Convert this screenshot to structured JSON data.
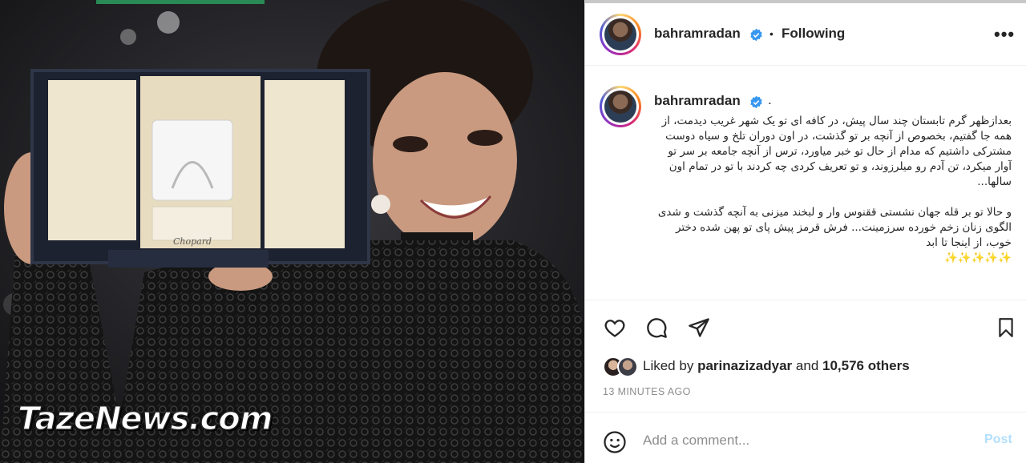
{
  "photo": {
    "description_icon": "photo-award-winner",
    "watermark": "TazeNews.com",
    "trophy_brand": "Chopard"
  },
  "header": {
    "username": "bahramradan",
    "separator": "•",
    "follow_status": "Following",
    "more_label": "•••"
  },
  "caption": {
    "username": "bahramradan",
    "suffix": ".",
    "paragraph1": "بعدازظهر گرم تابستان چند سال پیش، در کافه ای تو یک شهر غریب دیدمت، از همه جا گفتیم، بخصوص از آنچه بر تو گذشت، در اون دوران تلخ و سیاه دوست مشترکی داشتیم که مدام از حال تو خبر میاورد، ترس از آنچه جامعه بر سر تو آوار میکرد، تن آدم رو میلرزوند، و تو تعریف کردی چه کردند با تو در تمام اون سالها...",
    "paragraph2": "و حالا تو بر قله جهان نشستی ققنوس وار و لبخند میزنی به آنچه گذشت و شدی الگوی زنان زخم خورده سرزمینت... فرش قرمز پیش پای تو پهن شده دختر خوب، از اینجا تا ابد",
    "sparkles": "✨✨✨✨✨"
  },
  "actions": {
    "liked_prefix": "Liked by",
    "liked_user": "parinazizadyar",
    "liked_and": "and",
    "liked_count": "10,576 others",
    "timestamp": "13 MINUTES AGO"
  },
  "comment": {
    "placeholder": "Add a comment...",
    "post_label": "Post"
  },
  "colors": {
    "verified": "#3897f0",
    "post_disabled": "#b2dffc",
    "muted": "#8e8e8e"
  }
}
